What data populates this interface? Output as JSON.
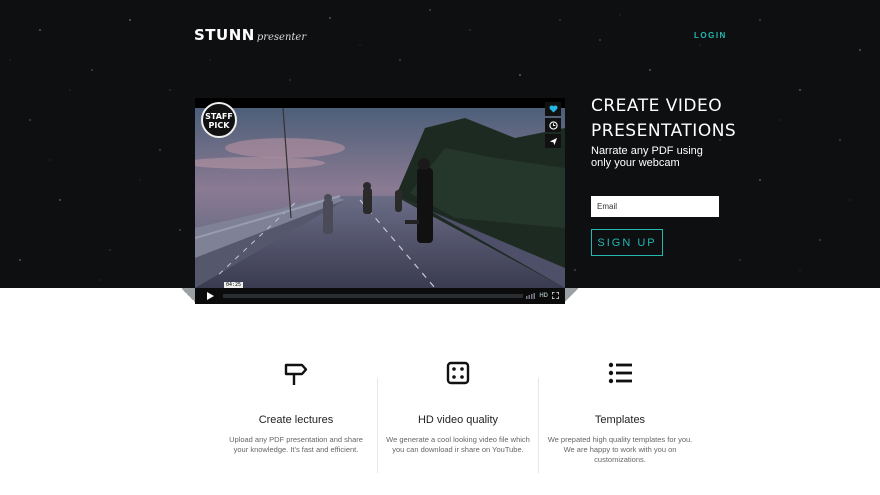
{
  "brand": {
    "name": "STUNN",
    "tagline": "presenter"
  },
  "nav": {
    "login_label": "LOGIN"
  },
  "colors": {
    "accent": "#25b7b2",
    "hero_bg": "#0e0f10"
  },
  "player": {
    "badge_line1": "STAFF",
    "badge_line2": "PICK",
    "time": "04:25",
    "side_icons": [
      "heart-icon",
      "clock-icon",
      "send-icon"
    ],
    "control_icons": [
      "volume-icon",
      "hd-icon",
      "fullscreen-icon"
    ],
    "hd_label": "HD"
  },
  "hero": {
    "title_line1": "CREATE VIDEO",
    "title_line2": "PRESENTATIONS",
    "subtitle_line1": "Narrate any PDF using",
    "subtitle_line2": "only your webcam",
    "email_placeholder": "Email",
    "signup_label": "SIGN UP"
  },
  "features": [
    {
      "icon": "signpost-icon",
      "title": "Create lectures",
      "desc_line1": "Upload any PDF presentation and share",
      "desc_line2": "your knowledge. It's fast and efficient."
    },
    {
      "icon": "dice-icon",
      "title": "HD video quality",
      "desc_line1": "We generate a cool looking video file which",
      "desc_line2": "you can download ir share on YouTube."
    },
    {
      "icon": "list-icon",
      "title": "Templates",
      "desc_line1": "We prepated high quality templates for you.",
      "desc_line2": "We are happy to work with you on",
      "desc_line3": "customizations."
    }
  ]
}
